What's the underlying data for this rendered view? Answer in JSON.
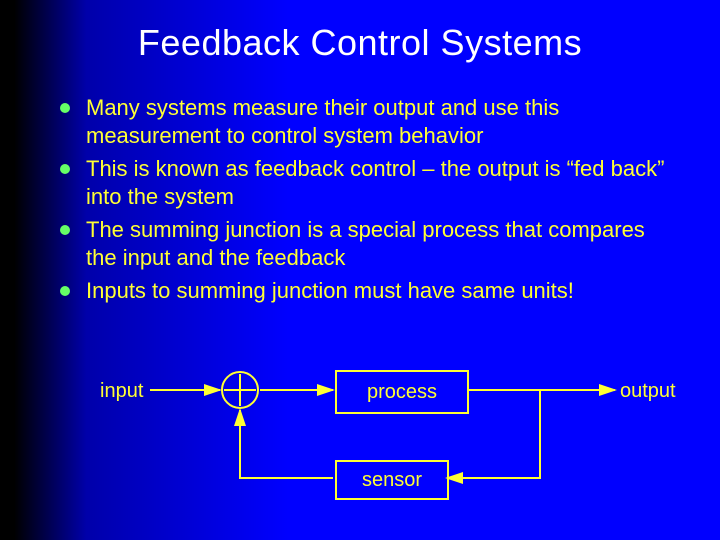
{
  "title": "Feedback Control Systems",
  "bullets": [
    "Many systems measure their output and use this measurement to control system behavior",
    "This is known as feedback control – the output is “fed back” into the system",
    "The summing junction is a special process that compares the input and the feedback",
    "Inputs to summing junction must have same units!"
  ],
  "diagram": {
    "input_label": "input",
    "process_label": "process",
    "sensor_label": "sensor",
    "output_label": "output"
  }
}
